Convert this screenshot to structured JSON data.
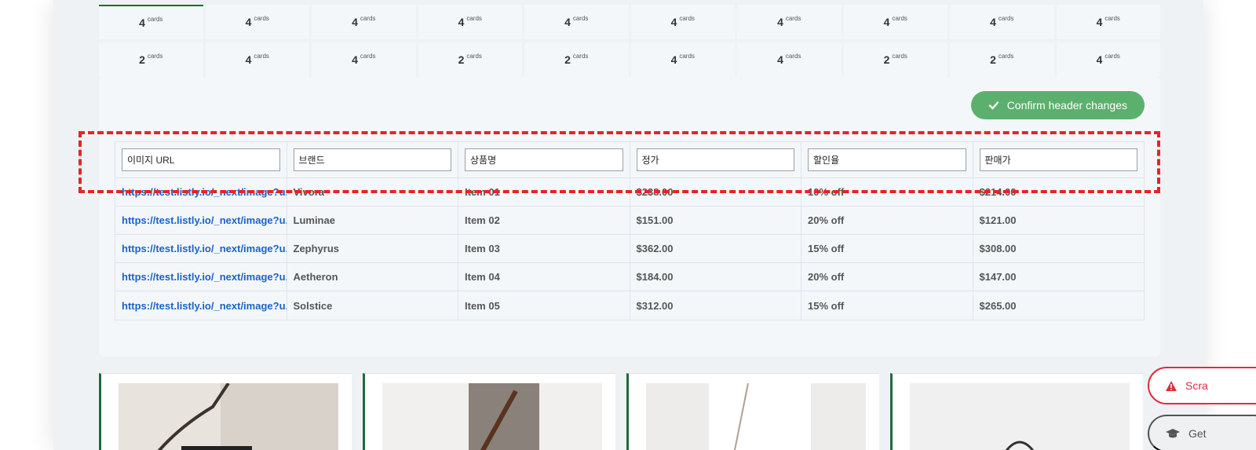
{
  "card_unit": "cards",
  "grid": {
    "row1": [
      "4",
      "4",
      "4",
      "4",
      "4",
      "4",
      "4",
      "4",
      "4",
      "4"
    ],
    "row2": [
      "2",
      "4",
      "4",
      "2",
      "2",
      "4",
      "4",
      "2",
      "2",
      "4"
    ]
  },
  "confirm_button": {
    "label": "Confirm header changes"
  },
  "table": {
    "headers": [
      "이미지 URL",
      "브랜드",
      "상품명",
      "정가",
      "할인율",
      "판매가"
    ],
    "rows": [
      [
        "https://test.listly.io/_next/image?u...",
        "Vivora",
        "Item 01",
        "$238.00",
        "10% off",
        "$214.00"
      ],
      [
        "https://test.listly.io/_next/image?u...",
        "Luminae",
        "Item 02",
        "$151.00",
        "20% off",
        "$121.00"
      ],
      [
        "https://test.listly.io/_next/image?u...",
        "Zephyrus",
        "Item 03",
        "$362.00",
        "15% off",
        "$308.00"
      ],
      [
        "https://test.listly.io/_next/image?u...",
        "Aetheron",
        "Item 04",
        "$184.00",
        "20% off",
        "$147.00"
      ],
      [
        "https://test.listly.io/_next/image?u...",
        "Solstice",
        "Item 05",
        "$312.00",
        "15% off",
        "$265.00"
      ]
    ]
  },
  "floating": {
    "scrape_label": "Scra",
    "get_label": "Get"
  },
  "colors": {
    "accent_green": "#5bb06e",
    "link_blue": "#1a63c8",
    "alert_red": "#e02d3c",
    "dark_green": "#1f6b3a"
  }
}
